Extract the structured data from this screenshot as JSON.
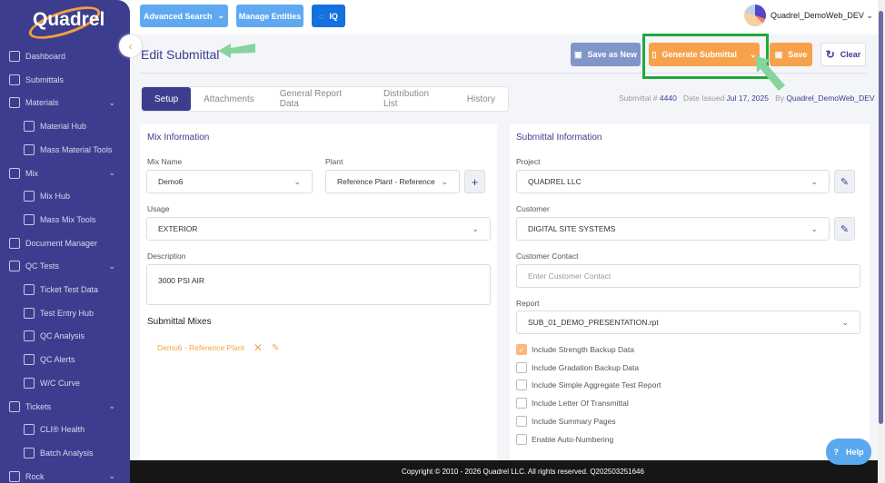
{
  "brand": "Quadrel",
  "sidebar": {
    "items": [
      {
        "label": "Dashboard",
        "sub": false
      },
      {
        "label": "Submittals",
        "sub": false
      },
      {
        "label": "Materials",
        "sub": false,
        "chev": true
      },
      {
        "label": "Material Hub",
        "sub": true
      },
      {
        "label": "Mass Material Tools",
        "sub": true
      },
      {
        "label": "Mix",
        "sub": false,
        "chev": true
      },
      {
        "label": "Mix Hub",
        "sub": true
      },
      {
        "label": "Mass Mix Tools",
        "sub": true
      },
      {
        "label": "Document Manager",
        "sub": false
      },
      {
        "label": "QC Tests",
        "sub": false,
        "chev": true
      },
      {
        "label": "Ticket Test Data",
        "sub": true
      },
      {
        "label": "Test Entry Hub",
        "sub": true
      },
      {
        "label": "QC Analysis",
        "sub": true
      },
      {
        "label": "QC Alerts",
        "sub": true
      },
      {
        "label": "W/C Curve",
        "sub": true
      },
      {
        "label": "Tickets",
        "sub": false,
        "chev": true
      },
      {
        "label": "CLI® Health",
        "sub": true
      },
      {
        "label": "Batch Analysis",
        "sub": true
      },
      {
        "label": "Rock",
        "sub": false,
        "chev": true
      }
    ]
  },
  "topbar": {
    "advanced_search": "Advanced Search",
    "manage_entities": "Manage Entities",
    "iq": "IQ",
    "user": "Quadrel_DemoWeb_DEV"
  },
  "page": {
    "title": "Edit Submittal",
    "save_as_new": "Save as New",
    "generate": "Generate Submittal",
    "save": "Save",
    "clear": "Clear"
  },
  "tabs": [
    "Setup",
    "Attachments",
    "General Report Data",
    "Distribution List",
    "History"
  ],
  "meta": {
    "submittal_label": "Submittal #",
    "submittal_no": "4440",
    "date_label": "Date Issued",
    "date": "Jul 17, 2025",
    "by_label": "By",
    "by": "Quadrel_DemoWeb_DEV"
  },
  "mix": {
    "heading": "Mix Information",
    "mix_name_label": "Mix Name",
    "mix_name": "Demo6",
    "plant_label": "Plant",
    "plant": "Reference Plant - Reference",
    "usage_label": "Usage",
    "usage": "EXTERIOR",
    "description_label": "Description",
    "description": "3000 PSI AIR",
    "mixes_heading": "Submittal Mixes",
    "mixes": [
      "Demo6 - Reference Plant"
    ]
  },
  "submittal": {
    "heading": "Submittal Information",
    "project_label": "Project",
    "project": "QUADREL LLC",
    "customer_label": "Customer",
    "customer": "DIGITAL SITE SYSTEMS",
    "contact_label": "Customer Contact",
    "contact_placeholder": "Enter Customer Contact",
    "report_label": "Report",
    "report": "SUB_01_DEMO_PRESENTATION.rpt",
    "options": [
      {
        "label": "Include Strength Backup Data",
        "checked": true
      },
      {
        "label": "Include Gradation Backup Data",
        "checked": false
      },
      {
        "label": "Include Simple Aggregate Test Report",
        "checked": false
      },
      {
        "label": "Include Letter Of Transmittal",
        "checked": false
      },
      {
        "label": "Include Summary Pages",
        "checked": false
      },
      {
        "label": "Enable Auto-Numbering",
        "checked": false
      }
    ]
  },
  "footer": "Copyright © 2010 - 2026 Quadrel LLC. All rights reserved. Q202503251646",
  "help": "Help"
}
